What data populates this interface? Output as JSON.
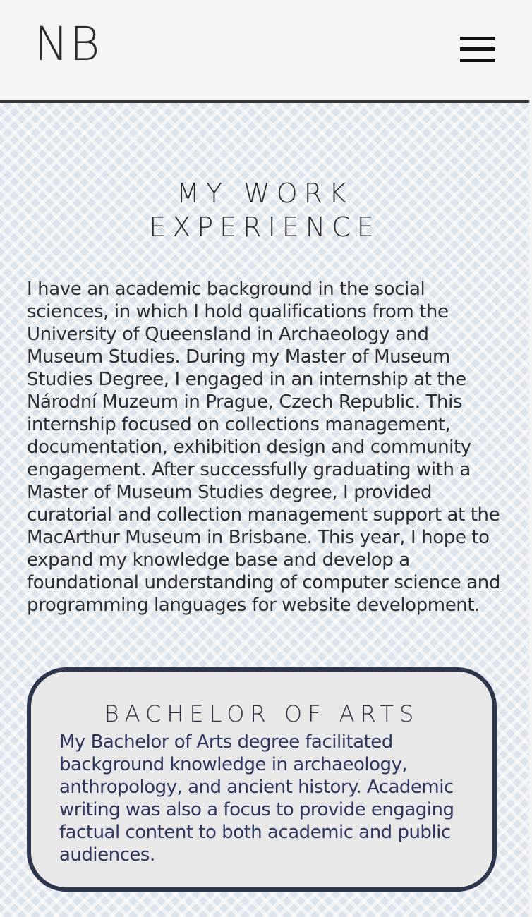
{
  "header": {
    "logo": "NB",
    "menu_icon": "hamburger-menu-icon"
  },
  "main": {
    "title_line1": "MY WORK",
    "title_line2": "EXPERIENCE",
    "intro": "I have an academic background in the social sciences, in which I hold qualifications from the University of Queensland in Archaeology and Museum Studies. During my Master of Museum Studies Degree, I engaged in an internship at the Národní Muzeum in Prague, Czech Republic. This internship focused on collections management, documentation, exhibition design and community engagement. After successfully graduating with a Master of Museum Studies degree, I provided curatorial and collection management support at the MacArthur Museum in Brisbane. This year, I hope to expand my knowledge base and develop a foundational understanding of computer science and programming languages for website development."
  },
  "cards": [
    {
      "title": "BACHELOR OF ARTS",
      "text": "My Bachelor of Arts degree facilitated background knowledge in archaeology, anthropology, and ancient history. Academic writing was also a focus to provide engaging factual content to both academic and public audiences."
    }
  ],
  "colors": {
    "header_bg": "#f5f5f5",
    "card_border": "#2e364d",
    "card_bg": "#e8e8e8",
    "text": "#2b2d33"
  }
}
